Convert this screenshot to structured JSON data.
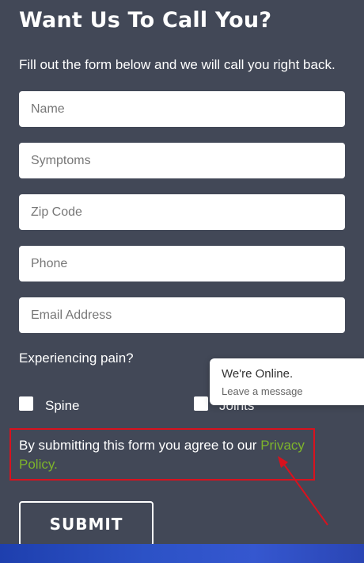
{
  "form": {
    "title": "Want Us To Call You?",
    "intro": "Fill out the form below and we will call you right back.",
    "fields": {
      "name_placeholder": "Name",
      "symptoms_placeholder": "Symptoms",
      "zip_placeholder": "Zip Code",
      "phone_placeholder": "Phone",
      "email_placeholder": "Email Address"
    },
    "pain_question": "Experiencing pain?",
    "options": {
      "spine": "Spine",
      "joints": "Joints"
    },
    "agreement_prefix": "By submitting this form you agree to our ",
    "privacy_link": "Privacy Policy.",
    "submit_label": "SUBMIT"
  },
  "chat_widget": {
    "status": "We're Online.",
    "prompt": "Leave a message"
  },
  "colors": {
    "background": "#424857",
    "link_accent": "#7db42b",
    "annotation": "#d8121e"
  }
}
